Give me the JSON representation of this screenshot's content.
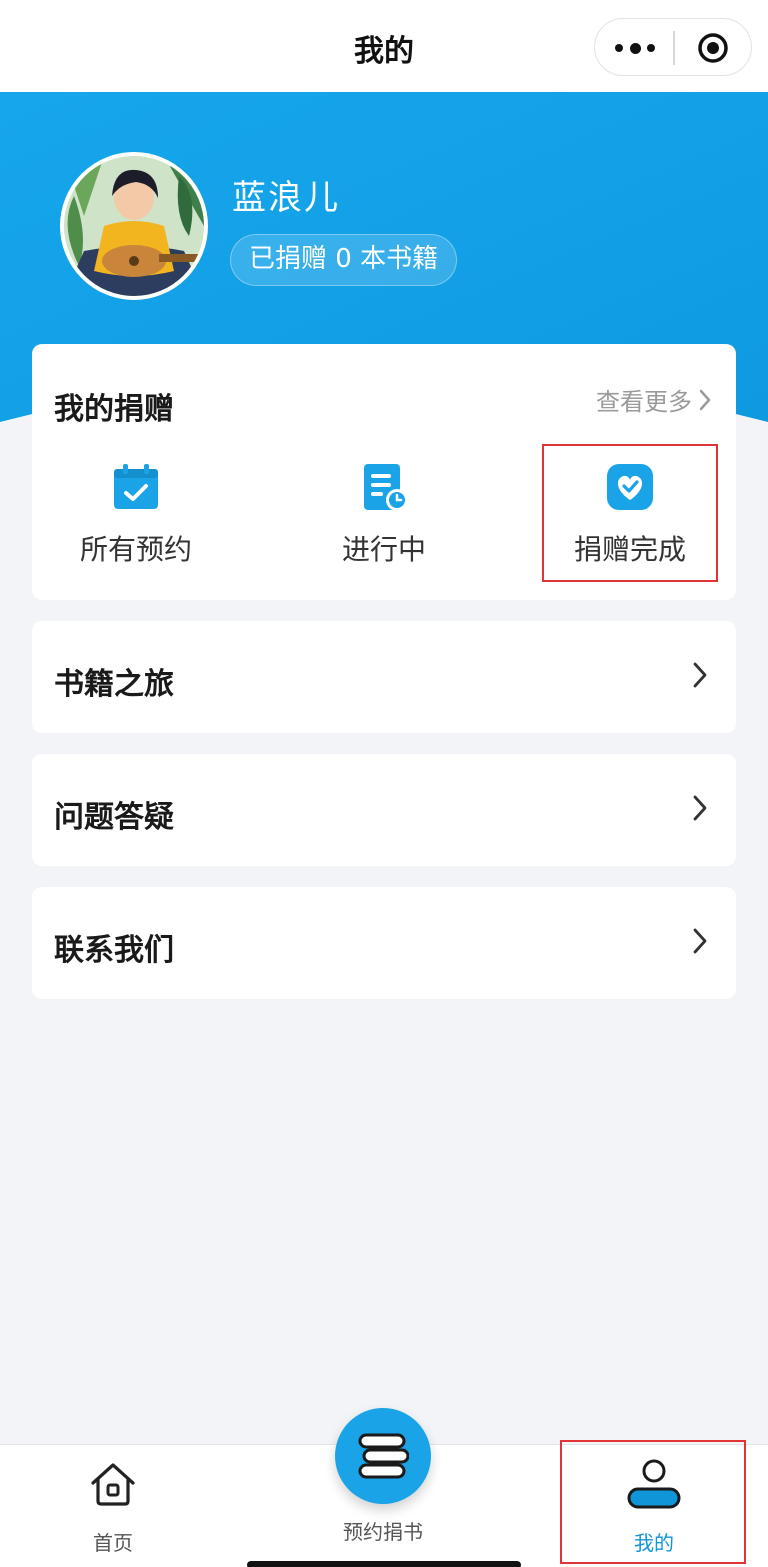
{
  "nav": {
    "title": "我的"
  },
  "profile": {
    "username": "蓝浪儿",
    "donated_text": "已捐赠 0 本书籍"
  },
  "donation": {
    "title": "我的捐赠",
    "view_more": "查看更多",
    "items": [
      {
        "label": "所有预约",
        "icon": "calendar-check-icon"
      },
      {
        "label": "进行中",
        "icon": "document-clock-icon"
      },
      {
        "label": "捐赠完成",
        "icon": "heart-check-icon"
      }
    ]
  },
  "menu": [
    {
      "label": "书籍之旅"
    },
    {
      "label": "问题答疑"
    },
    {
      "label": "联系我们"
    }
  ],
  "tabbar": {
    "home": "首页",
    "donate": "预约捐书",
    "mine": "我的",
    "active": "mine"
  },
  "colors": {
    "primary": "#1aa3e6",
    "active_tab": "#1096d8",
    "highlight_box": "#e23434"
  }
}
